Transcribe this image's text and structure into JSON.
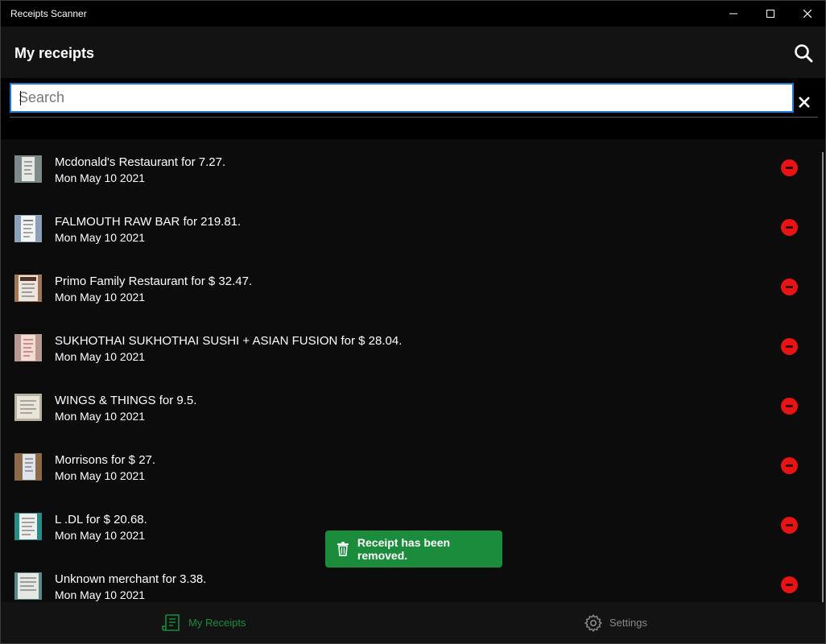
{
  "window": {
    "title": "Receipts Scanner"
  },
  "header": {
    "title": "My receipts"
  },
  "search": {
    "placeholder": "Search",
    "value": ""
  },
  "receipts": [
    {
      "title": "Mcdonald's Restaurant for 7.27.",
      "date": "Mon May 10 2021"
    },
    {
      "title": "FALMOUTH RAW BAR for 219.81.",
      "date": "Mon May 10 2021"
    },
    {
      "title": "Primo Family Restaurant for $ 32.47.",
      "date": "Mon May 10 2021"
    },
    {
      "title": "SUKHOTHAI SUKHOTHAI SUSHI + ASIAN FUSION for $ 28.04.",
      "date": "Mon May 10 2021"
    },
    {
      "title": "WINGS & THINGS for 9.5.",
      "date": "Mon May 10 2021"
    },
    {
      "title": "Morrisons for $ 27.",
      "date": "Mon May 10 2021"
    },
    {
      "title": "L .DL for $ 20.68.",
      "date": "Mon May 10 2021"
    },
    {
      "title": "Unknown merchant for 3.38.",
      "date": "Mon May 10 2021"
    }
  ],
  "toast": {
    "message": "Receipt has been removed.",
    "icon": "trash-icon",
    "color": "#1a8c3c"
  },
  "nav": {
    "receipts_label": "My Receipts",
    "settings_label": "Settings",
    "active": "My Receipts"
  },
  "colors": {
    "accent": "#1a8c3c",
    "delete": "#e81313",
    "focus": "#1e77d3"
  }
}
